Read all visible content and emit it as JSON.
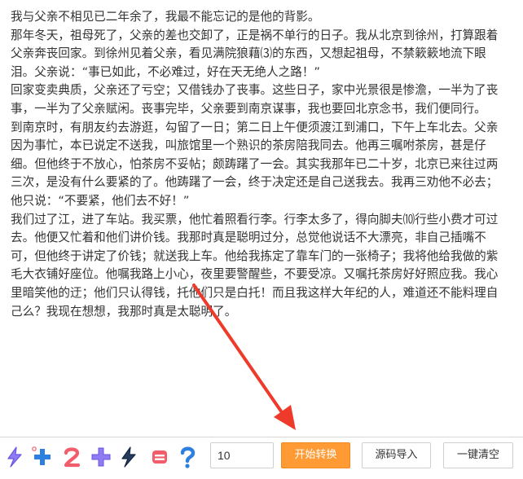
{
  "content": {
    "paragraphs": [
      "我与父亲不相见已二年余了，我最不能忘记的是他的背影。",
      "那年冬天，祖母死了，父亲的差也交卸了，正是祸不单行的日子。我从北京到徐州，打算跟着父亲奔丧回家。到徐州见着父亲，看见满院狼藉⑶的东西，又想起祖母，不禁簌簌地流下眼泪。父亲说：“事已如此，不必难过，好在天无绝人之路！”",
      "回家变卖典质，父亲还了亏空；又借钱办了丧事。这些日子，家中光景很是惨澹，一半为了丧事，一半为了父亲赋闲。丧事完毕，父亲要到南京谋事，我也要回北京念书，我们便同行。",
      "到南京时，有朋友约去游逛，勾留了一日；第二日上午便须渡江到浦口，下午上车北去。父亲因为事忙，本已说定不送我，叫旅馆里一个熟识的茶房陪我同去。他再三嘱咐茶房，甚是仔细。但他终于不放心，怕茶房不妥帖；颇踌躇了一会。其实我那年已二十岁，北京已来往过两三次，是没有什么要紧的了。他踌躇了一会，终于决定还是自己送我去。我再三劝他不必去；他只说：“不要紧，他们去不好！”",
      "我们过了江，进了车站。我买票，他忙着照看行李。行李太多了，得向脚夫⑽行些小费才可过去。他便又忙着和他们讲价钱。我那时真是聪明过分，总觉他说话不大漂亮，非自己插嘴不可，但他终于讲定了价钱；就送我上车。他给我拣定了靠车门的一张椅子；我将他给我做的紫毛大衣铺好座位。他嘱我路上小心，夜里要警醒些，不要受凉。又嘱托茶房好好照应我。我心里暗笑他的迂；他们只认得钱，托他们只是白托！而且我这样大年纪的人，难道还不能料理自己么？我现在想想，我那时真是太聪明了。"
    ]
  },
  "toolbar": {
    "icons": [
      "lightning-icon",
      "plus-icon",
      "number-two-icon",
      "plus-icon",
      "lightning-icon",
      "equals-icon",
      "question-icon"
    ],
    "input_value": "10",
    "start_label": "开始转换",
    "import_label": "源码导入",
    "clear_label": "一键清空"
  },
  "colors": {
    "accent": "#ff9a34",
    "arrow": "#ee3a2b",
    "icon_blue": "#2d7fe0",
    "icon_red": "#f25d6b",
    "icon_purple": "#7a5cf0",
    "icon_navy": "#243a5e"
  }
}
